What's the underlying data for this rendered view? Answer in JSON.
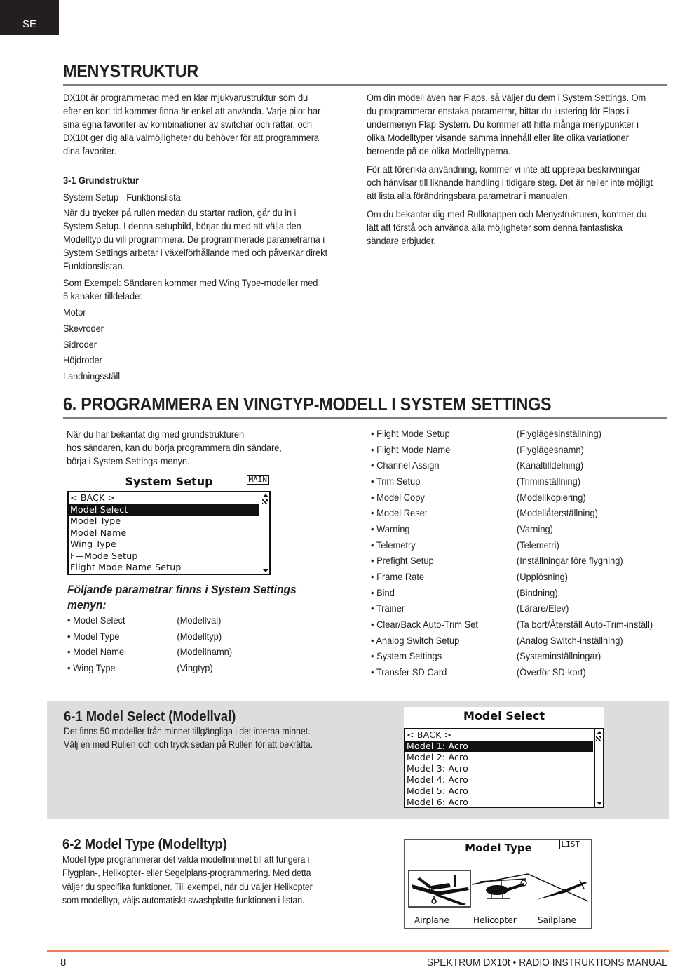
{
  "language_tab": "SE",
  "section_menu": {
    "title": "MENYSTRUKTUR",
    "intro": "DX10t är programmerad med en klar mjukvarustruktur som du efter en kort tid kommer finna är enkel att använda. Varje pilot har sina egna favoriter av kombinationer av switchar och rattar, och DX10t ger dig alla valmöjligheter du behöver för att programmera dina favoriter.",
    "subheading": "3-1 Grundstruktur",
    "subtitle": "System Setup - Funktionslista",
    "para1": "När du trycker på rullen medan du startar radion, går du in i System Setup. I denna setupbild, börjar du med att välja den Modelltyp du vill programmera. De programmerade parametrarna i System Settings arbetar i växelförhållande med och påverkar direkt Funktionslistan.",
    "para2": "Som Exempel: Sändaren kommer med Wing Type-modeller med 5 kanaker tilldelade:",
    "channels": [
      "Motor",
      "Skevroder",
      "Sidroder",
      "Höjdroder",
      "Landningsställ"
    ],
    "right_para1": "Om din modell även har Flaps, så väljer du dem i System Settings. Om du programmerar enstaka parametrar, hittar du justering för Flaps i undermenyn Flap System. Du kommer att hitta många menypunkter i olika Modelltyper visande samma innehåll eller lite olika variationer beroende på de olika Modelltyperna.",
    "right_para2": "För att förenkla användning, kommer vi inte att upprepa beskrivningar och hänvisar till liknande handling i tidigare steg. Det är heller inte möjligt att lista alla förändringsbara parametrar i manualen.",
    "right_para3": "Om du bekantar dig med Rullknappen och Menystrukturen, kommer du lätt att förstå och använda alla möjligheter som denna fantastiska sändare erbjuder."
  },
  "section_6": {
    "title": "6. PROGRAMMERA EN VINGTYP-MODELL I SYSTEM SETTINGS",
    "intro_lines": [
      "När du har bekantat dig med grundstrukturen",
      "hos sändaren, kan du börja programmera din sändare,",
      "börja i System Settings-menyn."
    ],
    "system_setup_screen": {
      "title": "System Setup",
      "tag": "MAIN",
      "items": [
        "< BACK >",
        "Model Select",
        "Model Type",
        "Model Name",
        "Wing Type",
        "F—Mode Setup",
        "Flight Mode Name Setup"
      ],
      "selected_index": 1
    },
    "params_heading": "Följande parametrar finns i System Settings menyn:",
    "params_left": [
      {
        "label": "• Model Select",
        "translation": "(Modellval)"
      },
      {
        "label": "• Model Type",
        "translation": "(Modelltyp)"
      },
      {
        "label": "• Model Name",
        "translation": "(Modellnamn)"
      },
      {
        "label": "• Wing Type",
        "translation": "(Vingtyp)"
      }
    ],
    "params_right": [
      {
        "label": "• Flight Mode Setup",
        "translation": "(Flyglägesinställning)"
      },
      {
        "label": "• Flight Mode Name",
        "translation": "(Flyglägesnamn)"
      },
      {
        "label": "• Channel Assign",
        "translation": "(Kanaltilldelning)"
      },
      {
        "label": "• Trim Setup",
        "translation": "(Triminställning)"
      },
      {
        "label": "• Model Copy",
        "translation": "(Modellkopiering)"
      },
      {
        "label": "• Model Reset",
        "translation": "(Modellåterställning)"
      },
      {
        "label": "• Warning",
        "translation": "(Varning)"
      },
      {
        "label": "• Telemetry",
        "translation": "(Telemetri)"
      },
      {
        "label": "• Prefight Setup",
        "translation": "(Inställningar före flygning)"
      },
      {
        "label": "• Frame Rate",
        "translation": "(Upplösning)"
      },
      {
        "label": "• Bind",
        "translation": "(Bindning)"
      },
      {
        "label": "• Trainer",
        "translation": "(Lärare/Elev)"
      },
      {
        "label": "• Clear/Back Auto-Trim Set",
        "translation": "(Ta bort/Återställ Auto-Trim-inställ)"
      },
      {
        "label": "• Analog Switch Setup",
        "translation": "(Analog Switch-inställning)"
      },
      {
        "label": "• System Settings",
        "translation": "(Systeminställningar)"
      },
      {
        "label": "• Transfer SD Card",
        "translation": "(Överför SD-kort)"
      }
    ]
  },
  "section_6_1": {
    "title": "6-1 Model Select  (Modellval)",
    "lines": [
      "Det finns 50 modeller från minnet  tillgängliga i det interna minnet.",
      "Välj en med Rullen och och tryck sedan på Rullen för att bekräfta."
    ],
    "screen": {
      "title": "Model Select",
      "items": [
        "< BACK >",
        "Model 1: Acro",
        "Model 2: Acro",
        "Model 3: Acro",
        "Model 4: Acro",
        "Model 5: Acro",
        "Model 6: Acro"
      ],
      "selected_index": 1
    }
  },
  "section_6_2": {
    "title": "6-2 Model Type  (Modelltyp)",
    "lines": [
      "Model type programmerar det valda modellminnet till att fungera i",
      "Flygplan-, Helikopter- eller Segelplans-programmering. Med detta",
      "väljer du specifika funktioner. Till exempel, när du väljer Helikopter",
      "som modelltyp, väljs automatiskt swashplatte-funktionen i listan."
    ],
    "screen": {
      "title": "Model Type",
      "tag": "LIST",
      "options": [
        "Airplane",
        "Helicopter",
        "Sailplane"
      ],
      "selected": "Airplane"
    }
  },
  "footer": {
    "page_number": "8",
    "manual_title": "SPEKTRUM DX10t • RADIO INSTRUKTIONS MANUAL",
    "accent_color": "#e8834a"
  }
}
